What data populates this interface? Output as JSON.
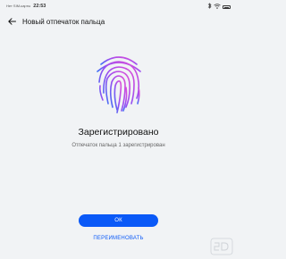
{
  "status_bar": {
    "carrier": "Нет SIM-карты",
    "time": "22:53",
    "icons": [
      "bluetooth-icon",
      "wifi-icon",
      "battery-icon"
    ]
  },
  "header": {
    "title": "Новый отпечаток пальца",
    "back_icon": "back-arrow-icon"
  },
  "main": {
    "fingerprint_icon": "fingerprint-icon",
    "status_title": "Зарегистрировано",
    "status_subtitle": "Отпечаток пальца 1 зарегистрирован"
  },
  "actions": {
    "ok_label": "ОК",
    "rename_label": "ПЕРЕИМЕНОВАТЬ"
  },
  "colors": {
    "accent": "#0a59f7",
    "background": "#f1f3f5",
    "fingerprint_gradient": [
      "#3b6ff5",
      "#9b4df0",
      "#e04fd8"
    ]
  }
}
